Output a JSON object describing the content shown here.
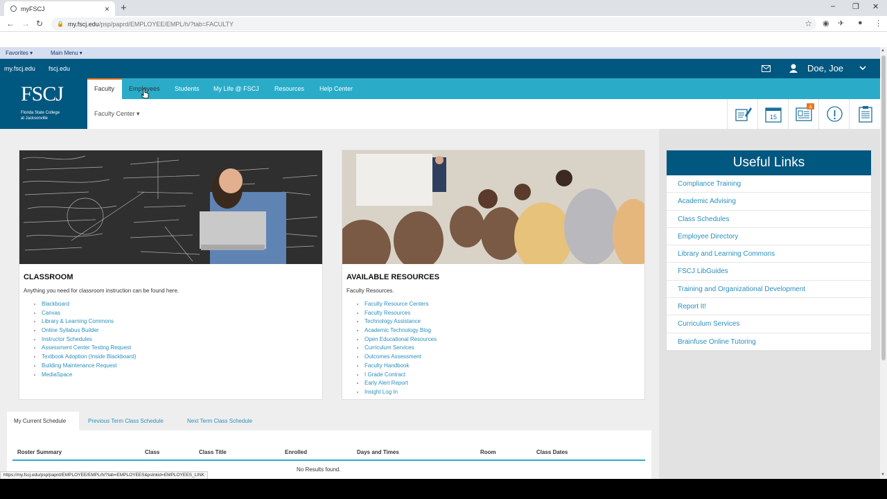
{
  "browser": {
    "tab_title": "myFSCJ",
    "url_host": "my.fscj.edu",
    "url_path": "/psp/paprd/EMPLOYEE/EMPL/h/?tab=FACULTY",
    "status_url": "https://my.fscj.edu/psp/paprd/EMPLOYEE/EMPL/h/?tab=EMPLOYEES&pslnkid=EMPLOYEES_LINK"
  },
  "menubar": {
    "favorites": "Favorites ▾",
    "main_menu": "Main Menu ▾"
  },
  "topbar": {
    "link1": "my.fscj.edu",
    "link2": "fscj.edu",
    "user": "Doe, Joe"
  },
  "logo": {
    "big": "FSCJ",
    "line1": "Florida State College",
    "line2": "at Jacksonville"
  },
  "nav": {
    "tabs": [
      "Faculty",
      "Employees",
      "Students",
      "My Life @ FSCJ",
      "Resources",
      "Help Center"
    ],
    "sub": "Faculty Center ▾",
    "badge": "4",
    "calendar_day": "15"
  },
  "classroom": {
    "title": "CLASSROOM",
    "desc": "Anything you need for classroom instruction can be found here.",
    "links": [
      "Blackboard",
      "Canvas",
      "Library & Learning Commons",
      "Online Syllabus Builder",
      "Instructor Schedules",
      "Assessment Center Testing Request",
      "Textbook Adoption (Inside Blackboard)",
      "Building Maintenance Request",
      "MediaSpace"
    ]
  },
  "resources": {
    "title": "AVAILABLE RESOURCES",
    "desc": "Faculty Resources.",
    "links": [
      "Faculty Resource Centers",
      "Faculty Resources",
      "Technology Assistance",
      "Academic Technology Blog",
      "Open Educational Resources",
      "Curriculum Services",
      "Outcomes Assessment",
      "Faculty Handbook",
      "I Grade Contract",
      "Early Alert Report",
      "Insight Log In"
    ]
  },
  "useful_links": {
    "title": "Useful Links",
    "items": [
      "Compliance Training",
      "Academic Advising",
      "Class Schedules",
      "Employee Directory",
      "Library and Learning Commons",
      "FSCJ LibGuides",
      "Training and Organizational Development",
      "Report It!",
      "Curriculum Services",
      "Brainfuse Online Tutoring"
    ]
  },
  "schedule": {
    "tabs": [
      "My Current Schedule",
      "Previous Term Class Schedule",
      "Next Term Class Schedule"
    ],
    "columns": [
      "Roster Summary",
      "Class",
      "Class Title",
      "Enrolled",
      "Days and Times",
      "Room",
      "Class Dates"
    ],
    "empty": "No Results found."
  }
}
